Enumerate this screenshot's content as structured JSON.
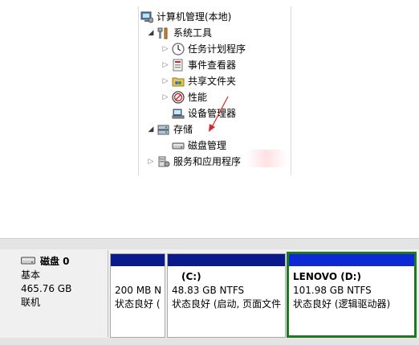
{
  "tree": {
    "root": "计算机管理(本地)",
    "system_tools": "系统工具",
    "task_scheduler": "任务计划程序",
    "event_viewer": "事件查看器",
    "shared_folders": "共享文件夹",
    "performance": "性能",
    "device_manager": "设备管理器",
    "storage": "存储",
    "disk_management": "磁盘管理",
    "services_apps": "服务和应用程序"
  },
  "disk": {
    "name": "磁盘 0",
    "type": "基本",
    "size": "465.76 GB",
    "status": "联机",
    "partitions": [
      {
        "title": "",
        "size": "200 MB N",
        "status": "状态良好 ("
      },
      {
        "title": "(C:)",
        "size": "48.83 GB NTFS",
        "status": "状态良好 (启动, 页面文件"
      },
      {
        "title": "LENOVO  (D:)",
        "size": "101.98 GB NTFS",
        "status": "状态良好 (逻辑驱动器)"
      }
    ]
  },
  "colors": {
    "primary_bar": "#0a1a8c",
    "logical_bar": "#0d29d6",
    "selection": "#1e7a22",
    "annotation_arrow": "#d9262b"
  }
}
